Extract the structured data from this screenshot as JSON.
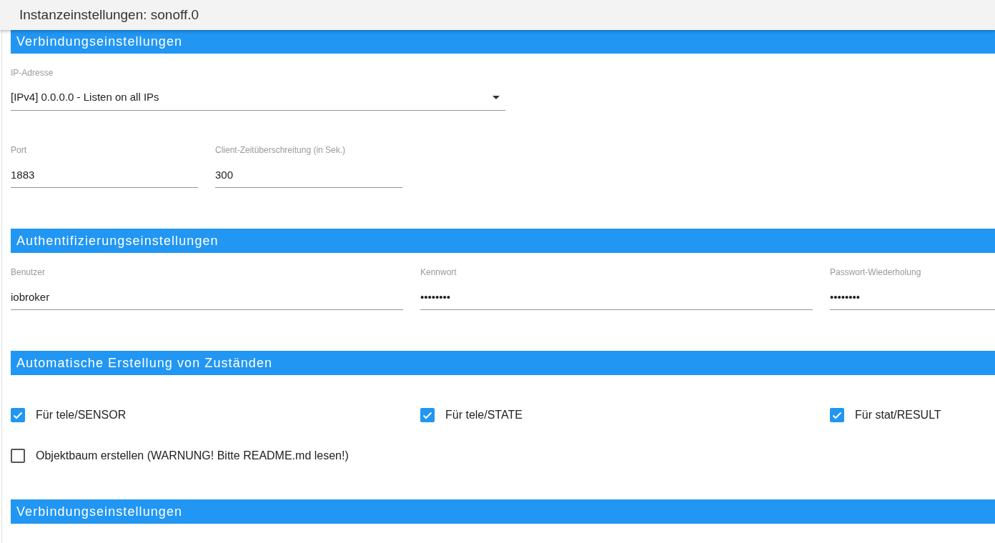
{
  "window": {
    "title": "Instanzeinstellungen: sonoff.0"
  },
  "sections": [
    {
      "kind": "fields",
      "title": "Verbindungseinstellungen",
      "rows": [
        [
          {
            "kind": "select",
            "label": "IP-Adresse",
            "value": "[IPv4] 0.0.0.0 - Listen on all IPs"
          }
        ],
        [
          {
            "kind": "text",
            "label": "Port",
            "value": "1883"
          },
          {
            "kind": "text",
            "label": "Client-Zeitüberschreitung (in Sek.)",
            "value": "300"
          }
        ]
      ]
    },
    {
      "kind": "fields",
      "title": "Authentifizierungseinstellungen",
      "rows": [
        [
          {
            "kind": "text",
            "label": "Benutzer",
            "value": "iobroker"
          },
          {
            "kind": "text",
            "label": "Kennwort",
            "value": "••••••••"
          },
          {
            "kind": "text",
            "label": "Passwort-Wiederholung",
            "value": "••••••••"
          }
        ]
      ]
    },
    {
      "kind": "checkboxes",
      "title": "Automatische Erstellung von Zuständen",
      "rows": [
        [
          {
            "label": "Für tele/SENSOR",
            "checked": true
          },
          {
            "label": "Für tele/STATE",
            "checked": true
          },
          {
            "label": "Für stat/RESULT",
            "checked": true
          }
        ],
        [
          {
            "label": "Objektbaum erstellen (WARNUNG! Bitte README.md lesen!)",
            "checked": false
          }
        ]
      ]
    },
    {
      "kind": "header",
      "title": "Verbindungseinstellungen"
    }
  ]
}
